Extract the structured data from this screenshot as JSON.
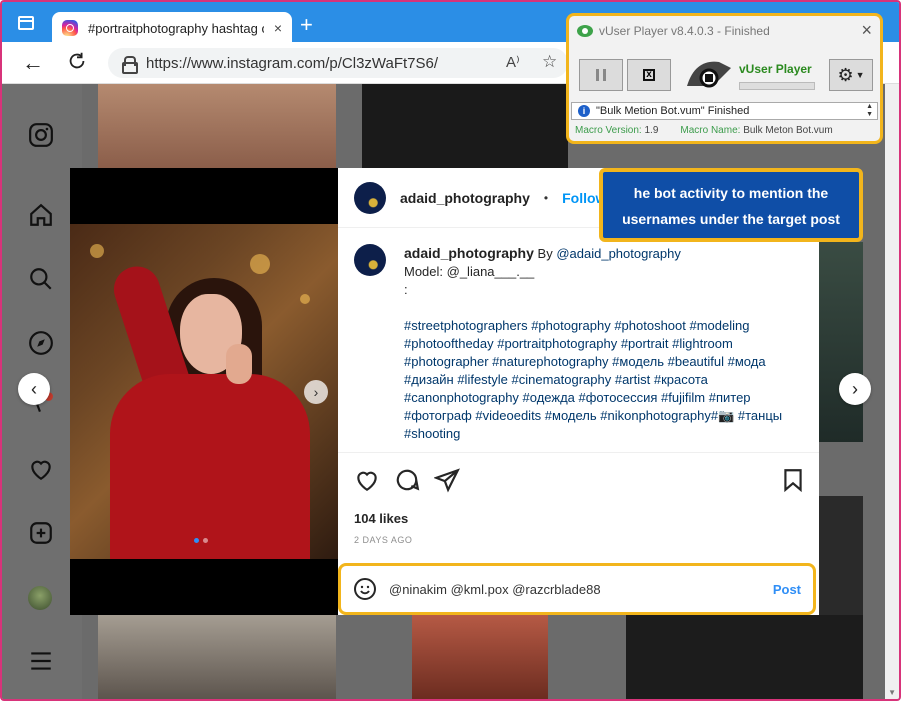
{
  "browser": {
    "tab_title": "#portraitphotography hashtag on Instagram",
    "tab_close": "×",
    "new_tab": "+",
    "url": "https://www.instagram.com/p/Cl3zWaFt7S6/",
    "read_aloud": "A⁾",
    "favorite": "☆"
  },
  "post": {
    "author": "adaid_photography",
    "separator": "•",
    "follow_label": "Follow",
    "caption_line1": "By ",
    "caption_mention": "@adaid_photography",
    "caption_line2": "Model: @_liana___.__",
    "caption_line3": ":",
    "hashtags": "#streetphotographers #photography #photoshoot #modeling #photooftheday #portraitphotography #portrait #lightroom #photographer #naturephotography #модель #beautiful #мода #дизайн #lifestyle #cinematography #artist #красота #canonphotography #одежда #фотосессия #fujifilm #питер #фотограф #videoedits #модель #nikonphotography#📷 #танцы #shooting",
    "likes": "104 likes",
    "date": "2 DAYS AGO",
    "comment_value": "@ninakim @kml.pox @razcrblade88",
    "post_label": "Post",
    "photo_index": 1,
    "photo_count": 2
  },
  "nav": {
    "prev": "‹",
    "next": "›"
  },
  "callout": {
    "line1": "he bot activity to mention the",
    "line2": "usernames under the target post"
  },
  "vuser": {
    "title": "vUser Player v8.4.0.3 - Finished",
    "close": "×",
    "brand": "vUser Player",
    "status": "\"Bulk Metion Bot.vum\" Finished",
    "macro_version_label": "Macro Version:",
    "macro_version": "1.9",
    "macro_name_label": "Macro Name:",
    "macro_name": "Bulk Meton Bot.vum",
    "stop_glyph": "x",
    "progress": 0
  },
  "colors": {
    "accent": "#0095f6",
    "highlight": "#f2b51c",
    "callout_bg": "#0f4ea7",
    "tab_bar": "#2b8ee6"
  }
}
